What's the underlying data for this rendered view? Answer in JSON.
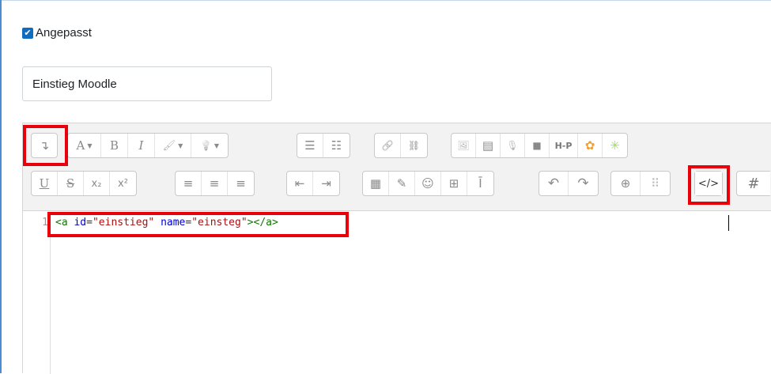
{
  "custom_checkbox": {
    "checked": true,
    "check_glyph": "✔",
    "label": "Angepasst"
  },
  "name_field": {
    "value": "Einstieg Moodle"
  },
  "toolbar": {
    "row1": [
      {
        "id": "toggle",
        "glyph": "↴",
        "icon": "show-more-toggle-icon"
      },
      {
        "id": "font-color",
        "glyph": "A",
        "icon": "font-color-icon"
      },
      {
        "id": "bold",
        "glyph": "B",
        "icon": "bold-icon"
      },
      {
        "id": "italic",
        "glyph": "I",
        "icon": "italic-icon"
      },
      {
        "id": "bg-color",
        "glyph": "🖌",
        "icon": "background-color-icon"
      },
      {
        "id": "style",
        "glyph": "💡",
        "icon": "paragraph-style-icon"
      },
      {
        "id": "ul",
        "glyph": "☰",
        "icon": "unordered-list-icon"
      },
      {
        "id": "ol",
        "glyph": "☷",
        "icon": "ordered-list-icon"
      },
      {
        "id": "link",
        "glyph": "🔗",
        "icon": "link-icon"
      },
      {
        "id": "unlink",
        "glyph": "⛓",
        "icon": "unlink-icon"
      },
      {
        "id": "image",
        "glyph": "🖼",
        "icon": "image-icon"
      },
      {
        "id": "media",
        "glyph": "▤",
        "icon": "media-file-icon"
      },
      {
        "id": "audio",
        "glyph": "🎙",
        "icon": "record-audio-icon"
      },
      {
        "id": "video",
        "glyph": "■",
        "icon": "record-video-icon"
      },
      {
        "id": "h5p",
        "glyph": "H-P",
        "icon": "h5p-icon"
      },
      {
        "id": "plugin1",
        "glyph": "✿",
        "icon": "plugin-flower-icon"
      },
      {
        "id": "plugin2",
        "glyph": "✳",
        "icon": "plugin-spinner-icon"
      }
    ],
    "row2": [
      {
        "id": "underline",
        "glyph": "U",
        "icon": "underline-icon"
      },
      {
        "id": "strike",
        "glyph": "S",
        "icon": "strikethrough-icon"
      },
      {
        "id": "sub",
        "glyph": "x₂",
        "icon": "subscript-icon"
      },
      {
        "id": "sup",
        "glyph": "x²",
        "icon": "superscript-icon"
      },
      {
        "id": "align-left",
        "glyph": "≡",
        "icon": "align-left-icon"
      },
      {
        "id": "align-center",
        "glyph": "≡",
        "icon": "align-center-icon"
      },
      {
        "id": "align-right",
        "glyph": "≡",
        "icon": "align-right-icon"
      },
      {
        "id": "outdent",
        "glyph": "⇤",
        "icon": "outdent-icon"
      },
      {
        "id": "indent",
        "glyph": "⇥",
        "icon": "indent-icon"
      },
      {
        "id": "equation",
        "glyph": "▦",
        "icon": "equation-icon"
      },
      {
        "id": "edit",
        "glyph": "✎",
        "icon": "edit-icon"
      },
      {
        "id": "emoji",
        "glyph": "☺",
        "icon": "emoticon-icon"
      },
      {
        "id": "table",
        "glyph": "⊞",
        "icon": "table-icon"
      },
      {
        "id": "special",
        "glyph": "Ī",
        "icon": "special-character-icon"
      },
      {
        "id": "undo",
        "glyph": "↶",
        "icon": "undo-icon"
      },
      {
        "id": "redo",
        "glyph": "↷",
        "icon": "redo-icon"
      },
      {
        "id": "accessibility",
        "glyph": "⊕",
        "icon": "accessibility-checker-icon"
      },
      {
        "id": "screenreader",
        "glyph": "⠿",
        "icon": "screenreader-helper-icon"
      },
      {
        "id": "html",
        "glyph": "</>",
        "icon": "html-code-icon"
      },
      {
        "id": "hash",
        "glyph": "#",
        "icon": "hash-icon"
      }
    ]
  },
  "code": {
    "line_number": "1",
    "tokens": {
      "open": "<a ",
      "attr1": "id",
      "eq1": "=",
      "val1": "\"einstieg\"",
      "sp": " ",
      "attr2": "name",
      "eq2": "=",
      "val2": "\"einsteg\"",
      "close": "></a>"
    }
  },
  "colors": {
    "highlight": "#e8000b",
    "checkbox": "#0f6cbf",
    "tag": "#117700",
    "attr": "#0000cc",
    "string": "#aa1111"
  }
}
